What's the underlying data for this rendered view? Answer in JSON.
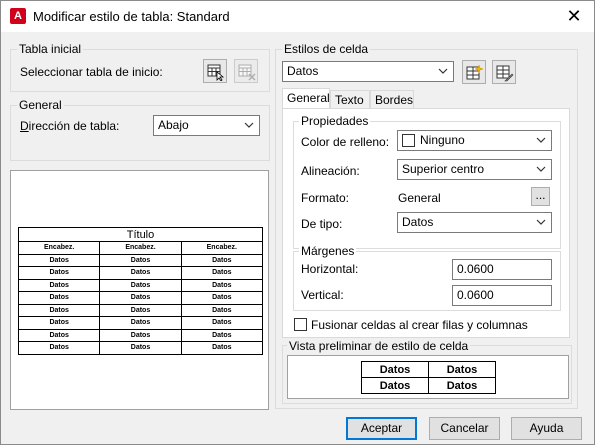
{
  "window": {
    "title": "Modificar estilo de tabla: Standard",
    "app_icon_glyph": "A",
    "close_glyph": "✕"
  },
  "initial_table": {
    "group_label": "Tabla inicial",
    "select_label": "Seleccionar tabla de inicio:"
  },
  "general": {
    "group_label": "General",
    "direction_label": "Dirección de tabla:",
    "direction_value": "Abajo"
  },
  "table_preview": {
    "title": "Título",
    "headers": [
      "Encabez.",
      "Encabez.",
      "Encabez."
    ],
    "rows": [
      [
        "Datos",
        "Datos",
        "Datos"
      ],
      [
        "Datos",
        "Datos",
        "Datos"
      ],
      [
        "Datos",
        "Datos",
        "Datos"
      ],
      [
        "Datos",
        "Datos",
        "Datos"
      ],
      [
        "Datos",
        "Datos",
        "Datos"
      ],
      [
        "Datos",
        "Datos",
        "Datos"
      ],
      [
        "Datos",
        "Datos",
        "Datos"
      ],
      [
        "Datos",
        "Datos",
        "Datos"
      ]
    ]
  },
  "cell_styles": {
    "group_label": "Estilos de celda",
    "selected": "Datos",
    "tabs": [
      "General",
      "Texto",
      "Bordes"
    ],
    "active_tab": "General"
  },
  "properties": {
    "group_label": "Propiedades",
    "fill_color_label": "Color de relleno:",
    "fill_color_value": "Ninguno",
    "alignment_label": "Alineación:",
    "alignment_value": "Superior centro",
    "format_label": "Formato:",
    "format_value": "General",
    "format_button": "...",
    "type_label": "De tipo:",
    "type_value": "Datos"
  },
  "margins": {
    "group_label": "Márgenes",
    "horizontal_label": "Horizontal:",
    "horizontal_value": "0.0600",
    "vertical_label": "Vertical:",
    "vertical_value": "0.0600"
  },
  "merge_cells": {
    "label": "Fusionar celdas al crear filas y columnas",
    "checked": false
  },
  "cell_preview": {
    "group_label": "Vista preliminar de estilo de celda",
    "cells": [
      [
        "Datos",
        "Datos"
      ],
      [
        "Datos",
        "Datos"
      ]
    ]
  },
  "buttons": {
    "accept": "Aceptar",
    "cancel": "Cancelar",
    "help": "Ayuda"
  }
}
